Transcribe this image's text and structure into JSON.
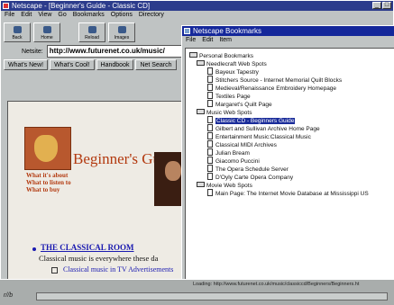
{
  "browser": {
    "title": "Netscape - [Beginner's Guide - Classic CD]",
    "menu": [
      "File",
      "Edit",
      "View",
      "Go",
      "Bookmarks",
      "Options",
      "Directory"
    ],
    "toolbar": [
      "Back",
      "Home",
      "Reload",
      "Images"
    ],
    "location_label": "Netsite:",
    "location_value": "http://www.futurenet.co.uk/music/",
    "directory_buttons": [
      "What's New!",
      "What's Cool!",
      "Handbook",
      "Net Search"
    ],
    "page": {
      "heading": "Beginner's Guide",
      "subs": [
        "What it's about",
        "What to listen to",
        "What to buy"
      ],
      "link": "THE CLASSICAL ROOM",
      "body": "Classical music is everywhere these da",
      "list_item": "Classical music in TV Advertisements"
    },
    "status": "Loading: http://www.futurenet.co.uk/music/classiccd/Beginners/Beginners.ht",
    "bottom_status": "r//b"
  },
  "bookmarks": {
    "title": "Netscape Bookmarks",
    "menu": [
      "File",
      "Edit",
      "Item"
    ],
    "items": [
      {
        "label": "Personal Bookmarks",
        "type": "folder",
        "level": 0
      },
      {
        "label": "Needlecraft Web Spots",
        "type": "folder",
        "level": 1
      },
      {
        "label": "Bayeux Tapestry",
        "type": "page",
        "level": 2
      },
      {
        "label": "Stitchers Source - Internet Memorial Quilt Blocks",
        "type": "page",
        "level": 2
      },
      {
        "label": "Medieval/Renaissance Embroidery Homepage",
        "type": "page",
        "level": 2
      },
      {
        "label": "Textiles Page",
        "type": "page",
        "level": 2
      },
      {
        "label": "Margaret's Quilt Page",
        "type": "page",
        "level": 2
      },
      {
        "label": "Music Web Spots",
        "type": "folder",
        "level": 1
      },
      {
        "label": "Classic CD - Beginners Guide",
        "type": "page",
        "level": 2,
        "selected": true
      },
      {
        "label": "Gilbert and Sullivan Archive Home Page",
        "type": "page",
        "level": 2
      },
      {
        "label": "Entertainment Music:Classical Music",
        "type": "page",
        "level": 2
      },
      {
        "label": "Classical MIDI Archives",
        "type": "page",
        "level": 2
      },
      {
        "label": "Julian Bream",
        "type": "page",
        "level": 2
      },
      {
        "label": "Giacomo Puccini",
        "type": "page",
        "level": 2
      },
      {
        "label": "The Opera Schedule Server",
        "type": "page",
        "level": 2
      },
      {
        "label": "D'Oyly Carte Opera Company",
        "type": "page",
        "level": 2
      },
      {
        "label": "Movie Web Spots",
        "type": "folder",
        "level": 1
      },
      {
        "label": "Main Page: The Internet Movie Database at Mississippi US",
        "type": "page",
        "level": 2
      }
    ]
  },
  "colors": {
    "titlebar": "#1b2f8c",
    "link": "#1a1ab0",
    "heading": "#b33a10"
  }
}
